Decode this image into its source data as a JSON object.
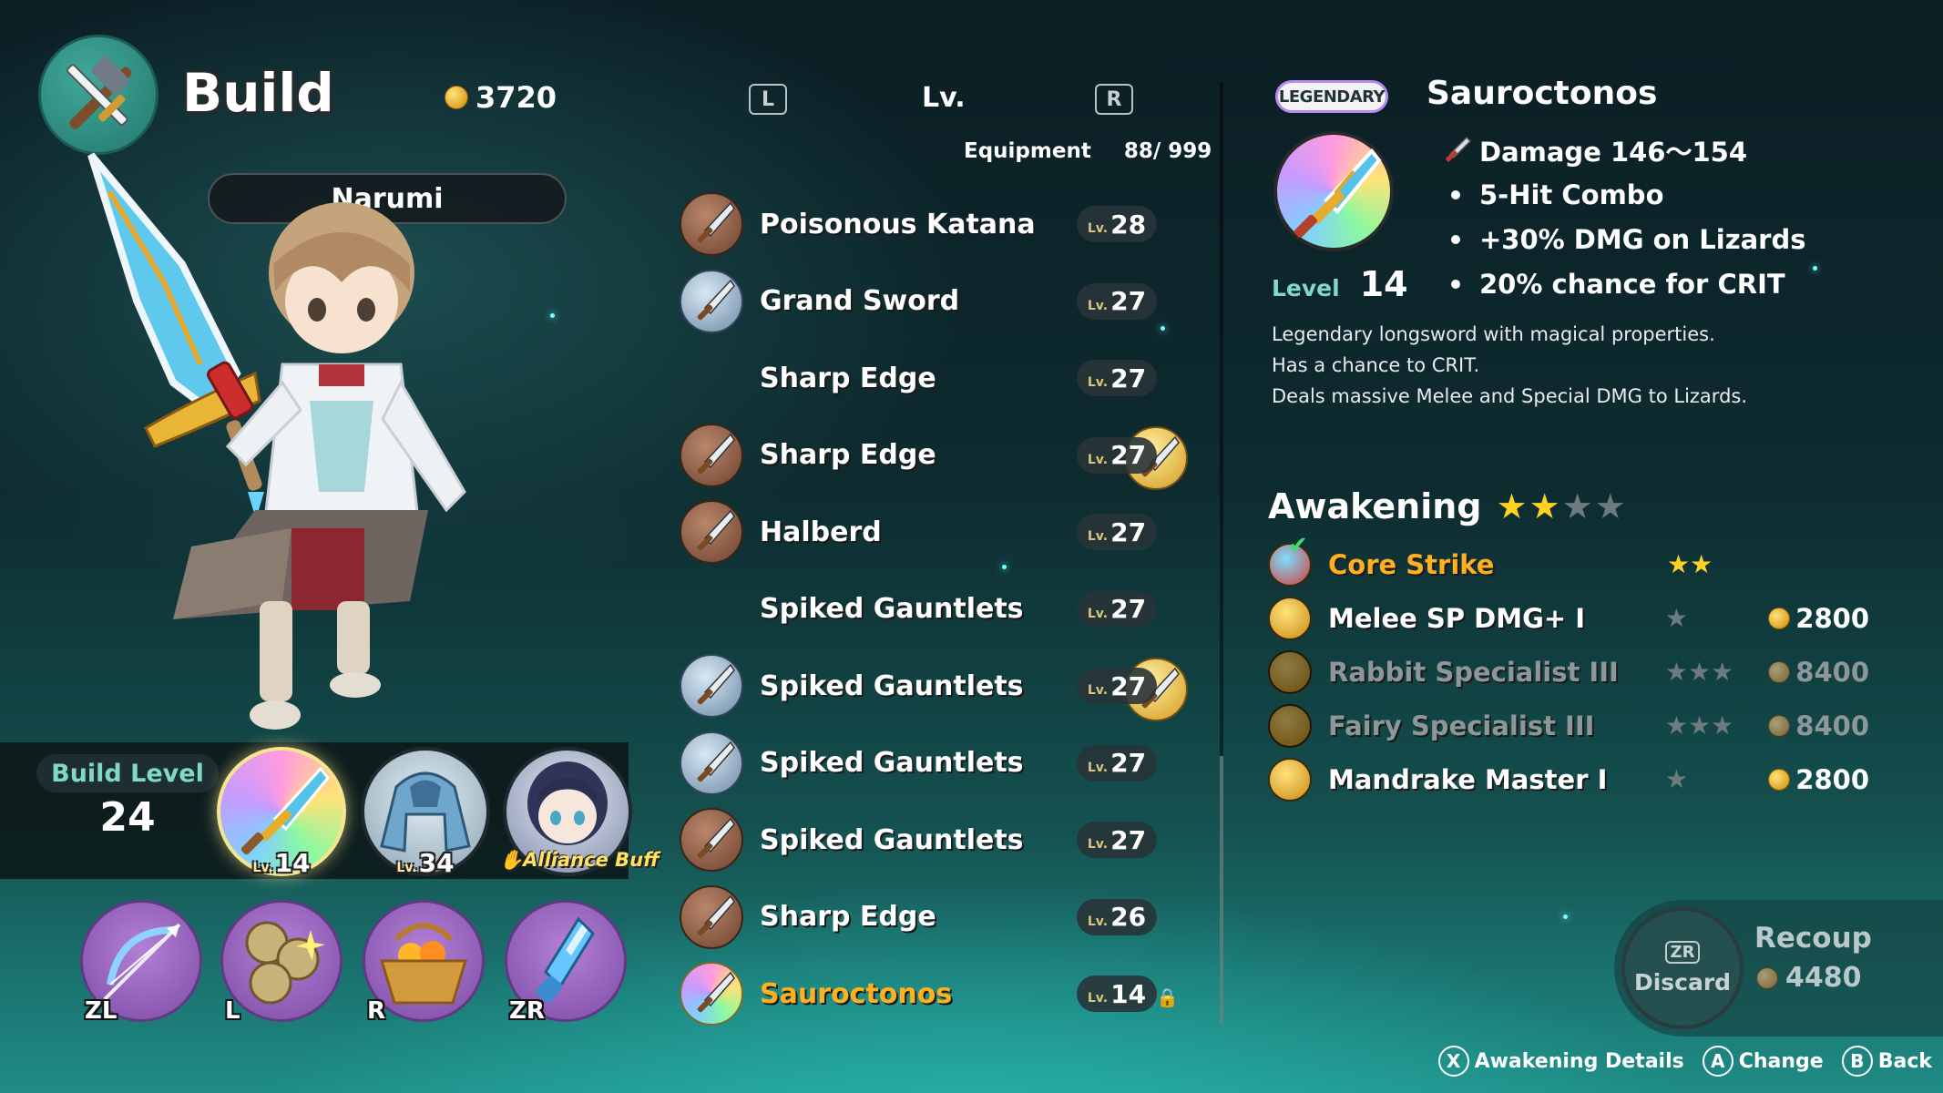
{
  "header": {
    "title": "Build",
    "gold": "3720"
  },
  "character": {
    "name": "Narumi",
    "build_level_label": "Build Level",
    "build_level": "24"
  },
  "slots": [
    {
      "name": "weapon",
      "lv_prefix": "Lv.",
      "lv": "14"
    },
    {
      "name": "armor",
      "lv_prefix": "Lv.",
      "lv": "34"
    },
    {
      "name": "buff",
      "label": "Alliance Buff"
    }
  ],
  "skills": [
    {
      "key": "ZL",
      "icon": "bow-icon"
    },
    {
      "key": "L",
      "icon": "orbs-icon"
    },
    {
      "key": "R",
      "icon": "basket-icon"
    },
    {
      "key": "ZR",
      "icon": "potion-icon"
    }
  ],
  "list_header": {
    "left_btn": "L",
    "title": "Lv.",
    "right_btn": "R",
    "equipment_label": "Equipment",
    "equipment_count": "88/ 999"
  },
  "equipment": [
    {
      "name": "Poisonous Katana",
      "lv_prefix": "Lv.",
      "lv": "28",
      "style": "bronze"
    },
    {
      "name": "Grand Sword",
      "lv_prefix": "Lv.",
      "lv": "27",
      "style": "silver"
    },
    {
      "name": "Sharp Edge",
      "lv_prefix": "Lv.",
      "lv": "27",
      "style": "gold"
    },
    {
      "name": "Sharp Edge",
      "lv_prefix": "Lv.",
      "lv": "27",
      "style": "bronze"
    },
    {
      "name": "Halberd",
      "lv_prefix": "Lv.",
      "lv": "27",
      "style": "bronze"
    },
    {
      "name": "Spiked Gauntlets",
      "lv_prefix": "Lv.",
      "lv": "27",
      "style": "gold"
    },
    {
      "name": "Spiked Gauntlets",
      "lv_prefix": "Lv.",
      "lv": "27",
      "style": "silver"
    },
    {
      "name": "Spiked Gauntlets",
      "lv_prefix": "Lv.",
      "lv": "27",
      "style": "silver"
    },
    {
      "name": "Spiked Gauntlets",
      "lv_prefix": "Lv.",
      "lv": "27",
      "style": "bronze"
    },
    {
      "name": "Sharp Edge",
      "lv_prefix": "Lv.",
      "lv": "26",
      "style": "bronze"
    },
    {
      "name": "Sauroctonos",
      "lv_prefix": "Lv.",
      "lv": "14",
      "style": "rainbow",
      "highlight": true,
      "locked": true
    }
  ],
  "detail": {
    "rarity": "LEGENDARY",
    "name": "Sauroctonos",
    "level_label": "Level",
    "level": "14",
    "stats": [
      "Damage 146～154",
      "5-Hit Combo",
      "+30% DMG on Lizards",
      "20% chance for CRIT"
    ],
    "description": [
      "Legendary longsword with magical properties.",
      "Has a chance to CRIT.",
      "Deals massive Melee and Special DMG to Lizards."
    ]
  },
  "awakening": {
    "title": "Awakening",
    "stars_filled": 2,
    "stars_total": 4,
    "items": [
      {
        "name": "Core Strike",
        "stars": 2,
        "active_stars": true,
        "cost": "",
        "core": true,
        "unlocked": true
      },
      {
        "name": "Melee SP DMG+ I",
        "stars": 1,
        "active_stars": false,
        "cost": "2800",
        "dim": false
      },
      {
        "name": "Rabbit Specialist III",
        "stars": 3,
        "active_stars": false,
        "cost": "8400",
        "dim": true
      },
      {
        "name": "Fairy Specialist III",
        "stars": 3,
        "active_stars": false,
        "cost": "8400",
        "dim": true
      },
      {
        "name": "Mandrake Master I",
        "stars": 1,
        "active_stars": false,
        "cost": "2800",
        "dim": false
      }
    ]
  },
  "recoup": {
    "btn_tag": "ZR",
    "discard_label": "Discard",
    "label": "Recoup",
    "value": "4480"
  },
  "footer": [
    {
      "key": "X",
      "label": "Awakening Details"
    },
    {
      "key": "A",
      "label": "Change"
    },
    {
      "key": "B",
      "label": "Back"
    }
  ],
  "colors": {
    "accent": "#ffb01f",
    "teal": "#7fd8c8",
    "star_on": "#ffd21f",
    "star_off": "#6d7a7e"
  }
}
